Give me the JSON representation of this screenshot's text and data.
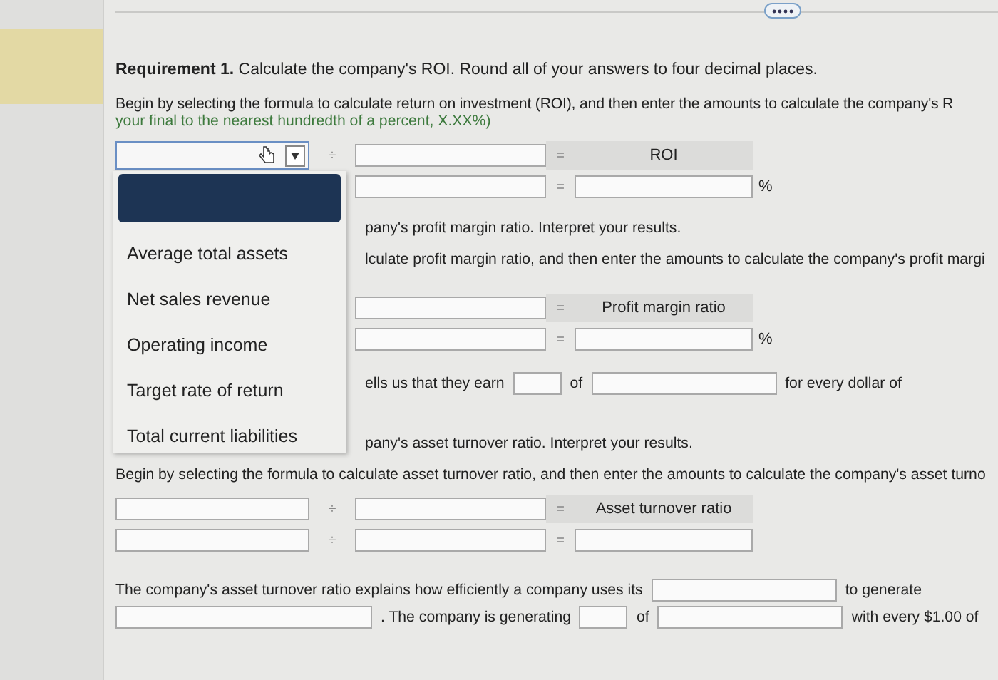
{
  "requirement_1": {
    "heading": "**Requirement 1.** Calculate the company's ROI. Round all of your answers to four decimal places.",
    "instruction": "Begin by selecting the formula to calculate return on investment (ROI), and then enter the amounts to calculate the company's R",
    "hint": "your final to the nearest hundredth of a percent, X.XX%)",
    "formula_rows": [
      {
        "cells": [
          {
            "kind": "select"
          },
          {
            "kind": "operator",
            "text": "÷"
          },
          {
            "kind": "field"
          },
          {
            "kind": "operator",
            "text": "="
          },
          {
            "kind": "header",
            "text": "ROI"
          }
        ]
      },
      {
        "cells": [
          {
            "kind": "blank"
          },
          {
            "kind": "blank"
          },
          {
            "kind": "field"
          },
          {
            "kind": "operator",
            "text": "="
          },
          {
            "kind": "field"
          },
          {
            "kind": "suffix",
            "text": "%"
          }
        ]
      }
    ],
    "dropdown": {
      "open": true,
      "options": [
        {
          "label": "Average total assets",
          "selected": false
        },
        {
          "label": "Net sales revenue",
          "selected": false
        },
        {
          "label": "Operating income",
          "selected": false
        },
        {
          "label": "Target rate of return",
          "selected": false
        },
        {
          "label": "Total current liabilities",
          "selected": false
        }
      ]
    }
  },
  "requirement_2": {
    "heading": "pany's profit margin ratio. Interpret your results.",
    "instruction": "lculate profit margin ratio, and then enter the amounts to calculate the company's profit margi",
    "formula_rows": [
      {
        "cells": [
          {
            "kind": "blank"
          },
          {
            "kind": "blank"
          },
          {
            "kind": "field"
          },
          {
            "kind": "operator",
            "text": "="
          },
          {
            "kind": "header",
            "text": "Profit margin ratio"
          }
        ]
      },
      {
        "cells": [
          {
            "kind": "blank"
          },
          {
            "kind": "blank"
          },
          {
            "kind": "field"
          },
          {
            "kind": "operator",
            "text": "="
          },
          {
            "kind": "field"
          },
          {
            "kind": "suffix",
            "text": "%"
          }
        ]
      }
    ],
    "sentences": [
      {
        "parts": [
          {
            "kind": "text",
            "text": "ells us that they earn"
          },
          {
            "kind": "short_field"
          },
          {
            "kind": "text",
            "text": "of"
          },
          {
            "kind": "wide_field"
          },
          {
            "kind": "text",
            "text": "for every dollar of"
          }
        ]
      }
    ]
  },
  "requirement_3": {
    "heading": "pany's asset turnover ratio. Interpret your results.",
    "instruction": "Begin by selecting the formula to calculate asset turnover ratio, and then enter the amounts to calculate the company's asset turno",
    "formula_rows": [
      {
        "cells": [
          {
            "kind": "field"
          },
          {
            "kind": "operator",
            "text": "÷"
          },
          {
            "kind": "field"
          },
          {
            "kind": "operator",
            "text": "="
          },
          {
            "kind": "header",
            "text": "Asset turnover ratio"
          }
        ]
      },
      {
        "cells": [
          {
            "kind": "field"
          },
          {
            "kind": "operator",
            "text": "÷"
          },
          {
            "kind": "field"
          },
          {
            "kind": "operator",
            "text": "="
          },
          {
            "kind": "field"
          }
        ]
      }
    ],
    "sentences": [
      {
        "parts": [
          {
            "kind": "text",
            "text": "The company's asset turnover ratio explains how efficiently a company uses its"
          },
          {
            "kind": "wide_field"
          },
          {
            "kind": "text",
            "text": "to generate"
          }
        ]
      },
      {
        "parts": [
          {
            "kind": "long_field"
          },
          {
            "kind": "text",
            "text": ". The company is generating"
          },
          {
            "kind": "short_field"
          },
          {
            "kind": "text",
            "text": "of"
          },
          {
            "kind": "wide_field"
          },
          {
            "kind": "text",
            "text": "with every $1.00 of"
          }
        ]
      }
    ]
  }
}
